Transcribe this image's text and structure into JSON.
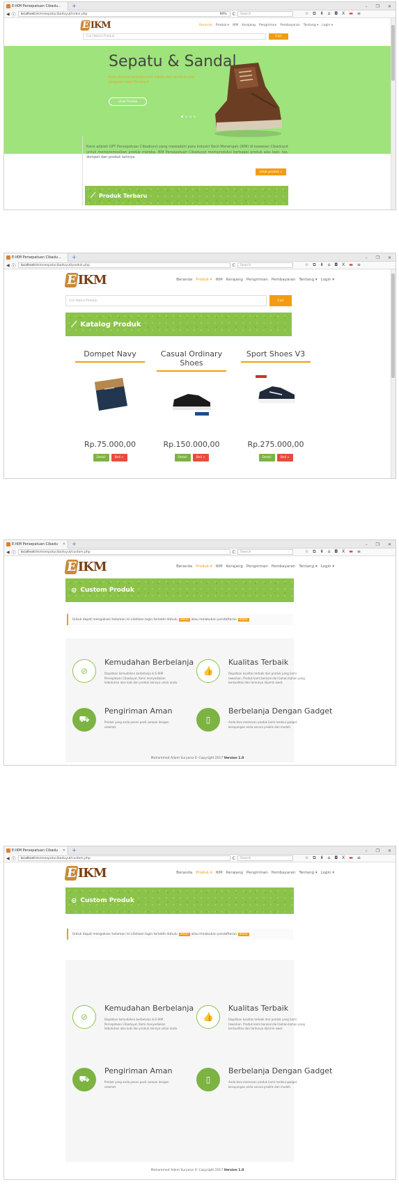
{
  "browser": {
    "tab1": "E-IKM Persepatuan Cibadu...",
    "tab_generic": "E-IKM Persepatuan Cibadu",
    "url_host": "localhost",
    "url_index": "/ekmseepatucibaduyut/index.php",
    "url_produk": "/ekmseepatucibaduyut/produk.php",
    "url_custom": "/ekmseepatucibaduyut/custom.php",
    "zoom": "90%",
    "search_placeholder": "Search",
    "win_min": "–",
    "win_max": "❐",
    "win_close": "✕",
    "new_tab": "+",
    "back": "◀",
    "info": "ⓘ",
    "reload": "C",
    "tb_star": "☆",
    "tb_lib": "⧉",
    "tb_down": "⬇",
    "tb_home": "⌂",
    "tb_shield": "◘",
    "tb_x": "X",
    "tb_flag": "▬",
    "tb_menu": "≡"
  },
  "site": {
    "logo_letter": "E",
    "logo_rest": "IKM",
    "menu": [
      "Beranda",
      "Produk ▾",
      "IKM",
      "Kerajang",
      "Pengiriman",
      "Pembayaran",
      "Tentang ▾",
      "Login ▾"
    ],
    "search_placeholder": "Cari Nama Produk",
    "search_button": "Cari"
  },
  "screen1": {
    "hero_title": "Sepatu & Sandal",
    "hero_subtitle": "Kami menjual berbagai jenis sepatu dan sandal buatan pengrajin lokal Cibaduyut",
    "hero_button": "Lihat Produk",
    "about_text": "Kami adalah UPT Persepatuan Cibaduyut yang mewadahi para Industri Kecil Menengah (IKM) di kawasan Cibaduyut untuk mempromosikan produk mereka. IKM Persepatuan Cibaduyut memproduksi berbagai produk alas kaki, tas, dompet dan produk lainnya.",
    "about_button": "Lihat produk »",
    "band_title": "Produk Terbaru"
  },
  "screen2": {
    "band_title": "Katalog Produk",
    "products": [
      {
        "name": "Dompet Navy",
        "price": "Rp.75.000,00"
      },
      {
        "name": "Casual Ordinary Shoes",
        "price": "Rp.150.000,00"
      },
      {
        "name": "Sport Shoes V3",
        "price": "Rp.275.000,00"
      }
    ],
    "detail_label": "Detail",
    "buy_label": "Beli »"
  },
  "custom": {
    "band_title": "Custom Produk",
    "notice_text": "Untuk dapat mengakses halaman ini silahkan login terlebih dahulu",
    "notice_login": "disini",
    "notice_mid": "atau melakukan pendaftaran",
    "notice_register": "disini",
    "features": [
      {
        "title": "Kemudahan Berbelanja",
        "text": "Dapatkan kemudahan berbelanja di E-IKM Persepatuan Cibaduyut, Kami menyediakan kebutuhan alas kaki dan produk lainnya untuk anda.",
        "icon": "⊘"
      },
      {
        "title": "Kualitas Terbaik",
        "text": "Dapatkan kualitas terbaik dari produk yang kami tawarkan. Produk kami berasal dari bahan-bahan yang berkualitas dan tentunya dijamin awet.",
        "icon": "👍"
      },
      {
        "title": "Pengiriman Aman",
        "text": "Produk yang anda pesan pasti sampai dengan selamat.",
        "icon": "⛟"
      },
      {
        "title": "Berbelanja Dengan Gadget",
        "text": "Anda bisa memesan produk kami melalui gadget kesayangan anda secara praktis dan mudah.",
        "icon": "▯"
      }
    ],
    "footer_text": "Muhammad Adam Suryana © Copyright 2017",
    "footer_version": "Version 1.0"
  }
}
